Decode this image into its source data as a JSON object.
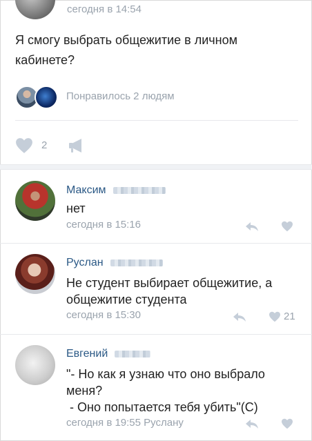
{
  "post": {
    "time": "сегодня в 14:54",
    "text": "Я смогу выбрать общежитие в личном кабинете?",
    "liked_by_text": "Понравилось 2 людям",
    "like_count": "2"
  },
  "comments": [
    {
      "name": "Максим",
      "text": "нет",
      "time": "сегодня в 15:16",
      "likes": ""
    },
    {
      "name": "Руслан",
      "text": "Не студент выбирает общежитие, а общежитие студента",
      "time": "сегодня в 15:30",
      "likes": "21"
    },
    {
      "name": "Евгений",
      "text_line1": "\"- Но как я узнаю что оно выбрало меня?",
      "text_line2": " - Оно попытается тебя убить\"(С)",
      "time": "сегодня в 19:55 Руслану",
      "likes": ""
    }
  ],
  "icons": {
    "heart": "heart-icon",
    "share": "megaphone-icon",
    "reply": "reply-arrow-icon"
  },
  "colors": {
    "name_link": "#2a5885",
    "muted": "#9aa3ad",
    "icon": "#c5ced9"
  }
}
